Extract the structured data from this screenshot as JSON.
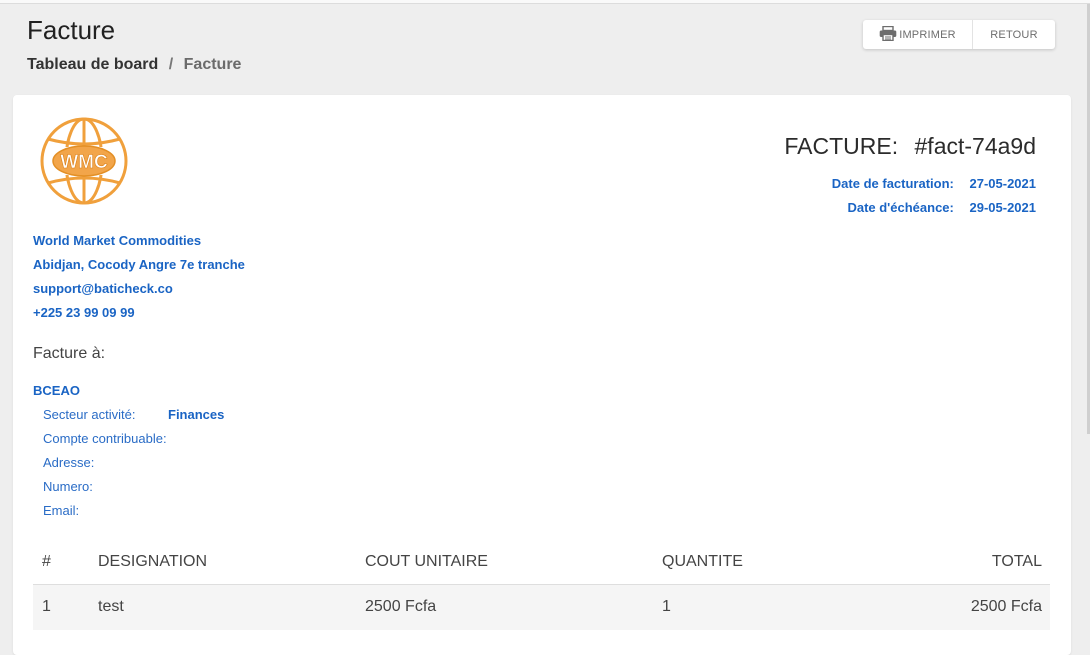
{
  "header": {
    "title": "Facture",
    "breadcrumb": {
      "parent": "Tableau de board",
      "separator": "/",
      "current": "Facture"
    },
    "buttons": {
      "print_label": "IMPRIMER",
      "back_label": "RETOUR"
    }
  },
  "invoice": {
    "title_label": "FACTURE:",
    "number": "#fact-74a9d",
    "date_label": "Date de facturation:",
    "date": "27-05-2021",
    "due_label": "Date d'échéance:",
    "due_date": "29-05-2021"
  },
  "company": {
    "logo_text": "WMC",
    "name": "World Market Commodities",
    "address": "Abidjan, Cocody Angre 7e tranche",
    "email": "support@baticheck.co",
    "phone": "+225 23 99 09 99"
  },
  "client": {
    "heading": "Facture à:",
    "name": "BCEAO",
    "sector_label": "Secteur activité:",
    "sector": "Finances",
    "taxpayer_label": "Compte contribuable:",
    "address_label": "Adresse:",
    "number_label": "Numero:",
    "email_label": "Email:"
  },
  "table": {
    "headers": [
      "#",
      "DESIGNATION",
      "COUT UNITAIRE",
      "QUANTITE",
      "TOTAL"
    ],
    "rows": [
      [
        "1",
        "test",
        "2500 Fcfa",
        "1",
        "2500 Fcfa"
      ]
    ]
  },
  "colors": {
    "accent": "#1a64c4",
    "logo": "#f0a03c"
  },
  "icons": {
    "print": "printer-icon"
  }
}
